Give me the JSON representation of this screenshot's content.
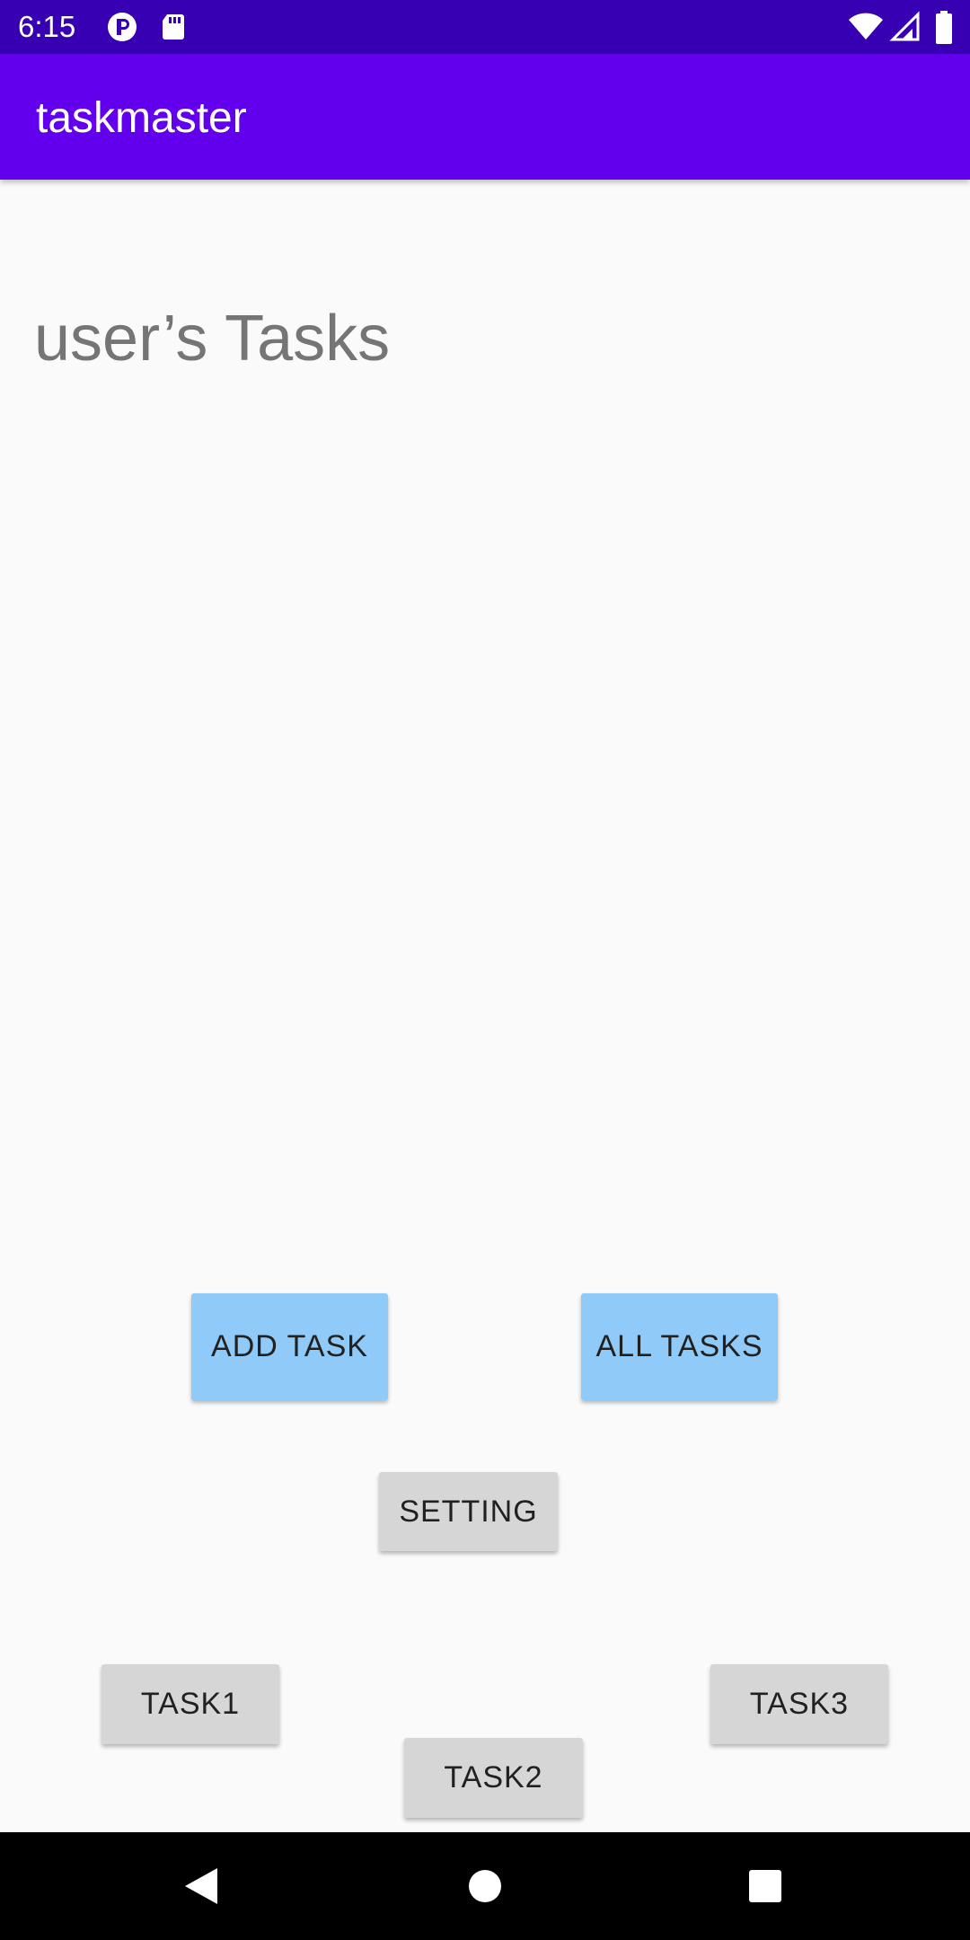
{
  "status_bar": {
    "time": "6:15",
    "icons": [
      "data-saver-icon",
      "sd-card-icon",
      "wifi-icon",
      "cell-signal-icon",
      "battery-icon"
    ]
  },
  "app_bar": {
    "title": "taskmaster"
  },
  "main": {
    "heading": "user’s Tasks",
    "buttons": {
      "add_task": "ADD TASK",
      "all_tasks": "ALL TASKS",
      "setting": "SETTING",
      "task1": "TASK1",
      "task2": "TASK2",
      "task3": "TASK3"
    }
  },
  "nav_bar": {
    "icons": [
      "back-icon",
      "home-icon",
      "recents-icon"
    ]
  },
  "colors": {
    "status_bar": "#3700B3",
    "app_bar": "#6200EE",
    "primary_button": "#90CAF9",
    "secondary_button": "#D6D6D6",
    "background": "#FAFAFA"
  }
}
